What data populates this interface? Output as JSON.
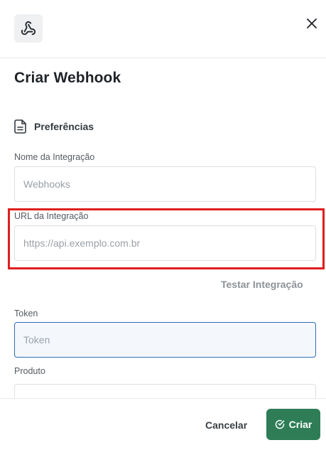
{
  "header": {
    "logo_icon": "webhook-icon",
    "close_icon": "close-icon"
  },
  "title": "Criar Webhook",
  "section": {
    "icon": "document-icon",
    "label": "Preferências"
  },
  "fields": {
    "name": {
      "label": "Nome da Integração",
      "placeholder": "Webhooks",
      "value": ""
    },
    "url": {
      "label": "URL da Integração",
      "placeholder": "https://api.exemplo.com.br",
      "value": ""
    },
    "token": {
      "label": "Token",
      "placeholder": "Token",
      "value": ""
    },
    "product": {
      "label": "Produto",
      "placeholder": "",
      "value": ""
    }
  },
  "test_link": "Testar Integração",
  "footer": {
    "cancel_label": "Cancelar",
    "create_label": "Criar",
    "create_icon": "check-circle-icon"
  },
  "colors": {
    "primary": "#2e7d57",
    "highlight": "#e01e1e",
    "focus_border": "#2f6db5"
  }
}
